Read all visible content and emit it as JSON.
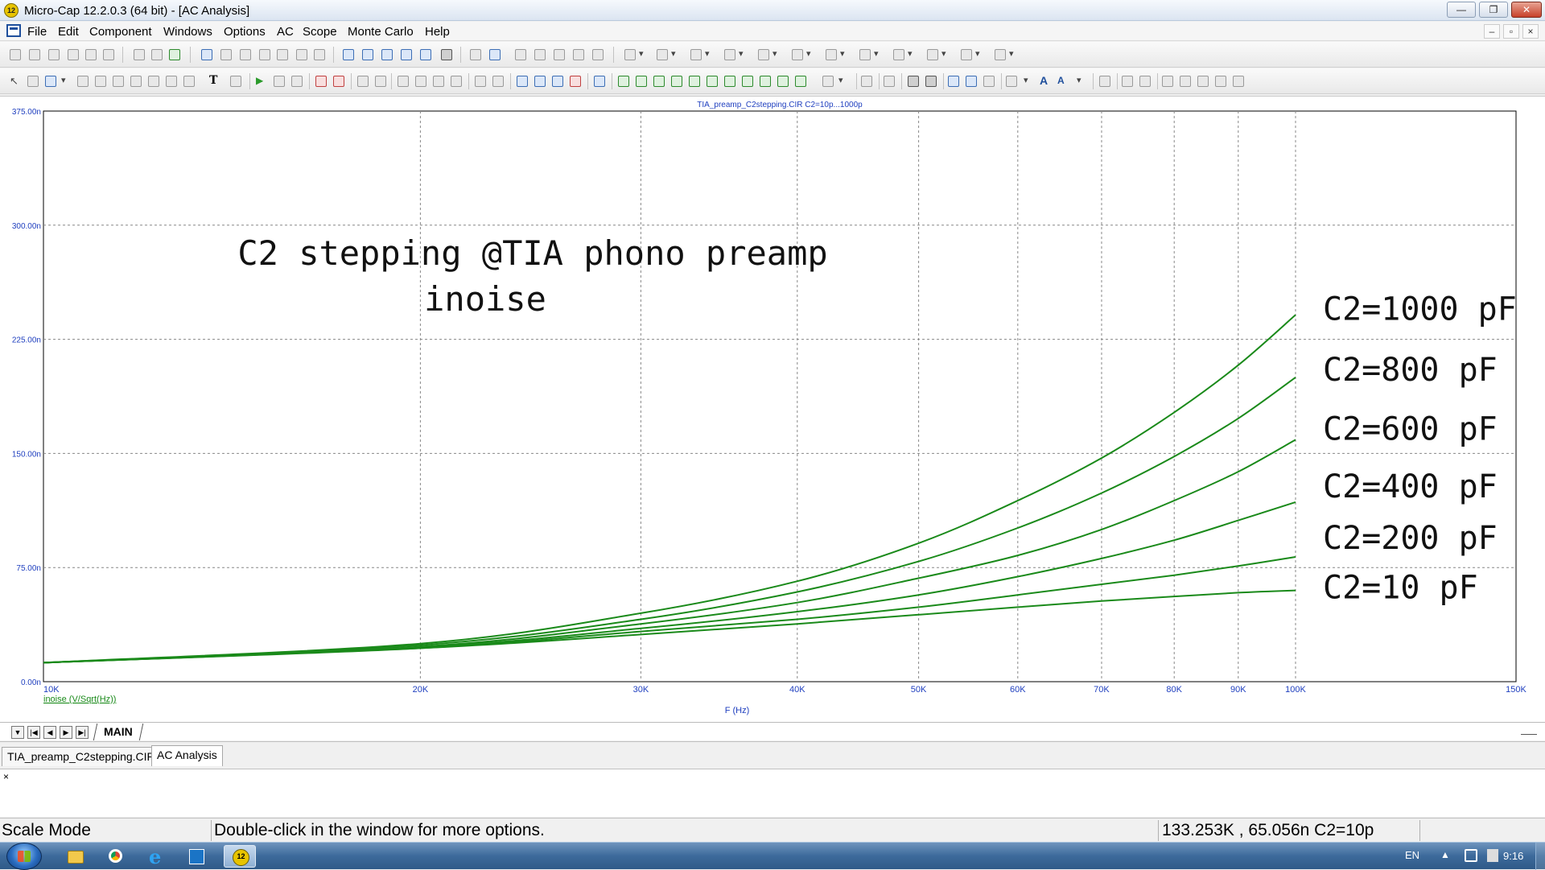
{
  "window": {
    "title": "Micro-Cap 12.2.0.3 (64 bit) - [AC Analysis]",
    "app_icon_text": "12",
    "minimize_glyph": "—",
    "restore_glyph": "❐",
    "close_glyph": "✕"
  },
  "menu": {
    "items": [
      "File",
      "Edit",
      "Component",
      "Windows",
      "Options",
      "AC",
      "Scope",
      "Monte Carlo",
      "Help"
    ],
    "mdi_min": "–",
    "mdi_restore": "▫",
    "mdi_close": "×"
  },
  "plot": {
    "header": "TIA_preamp_C2stepping.CIR C2=10p...1000p",
    "trace_label": "inoise (V/Sqrt(Hz))",
    "x_axis_label": "F (Hz)",
    "annotation_title": "C2 stepping @TIA phono preamp",
    "annotation_subtitle": "inoise",
    "trace_color": "#1a8a1a"
  },
  "chart_data": {
    "type": "line",
    "title": "TIA_preamp_C2stepping.CIR C2=10p...1000p",
    "xlabel": "F (Hz)",
    "ylabel": "inoise (V/Sqrt(Hz))",
    "x_scale": "log",
    "xlim": [
      10000,
      150000
    ],
    "ylim": [
      0,
      375
    ],
    "y_unit": "nV/Sqrt(Hz)",
    "grid": true,
    "x_ticks": [
      {
        "value": 10000,
        "label": "10K"
      },
      {
        "value": 20000,
        "label": "20K"
      },
      {
        "value": 30000,
        "label": "30K"
      },
      {
        "value": 40000,
        "label": "40K"
      },
      {
        "value": 50000,
        "label": "50K"
      },
      {
        "value": 60000,
        "label": "60K"
      },
      {
        "value": 70000,
        "label": "70K"
      },
      {
        "value": 80000,
        "label": "80K"
      },
      {
        "value": 90000,
        "label": "90K"
      },
      {
        "value": 100000,
        "label": "100K"
      },
      {
        "value": 150000,
        "label": "150K"
      }
    ],
    "y_ticks": [
      {
        "value": 0,
        "label": "0.00n"
      },
      {
        "value": 75,
        "label": "75.00n"
      },
      {
        "value": 150,
        "label": "150.00n"
      },
      {
        "value": 225,
        "label": "225.00n"
      },
      {
        "value": 300,
        "label": "300.00n"
      },
      {
        "value": 375,
        "label": "375.00n"
      }
    ],
    "x": [
      10000,
      20000,
      30000,
      40000,
      50000,
      60000,
      70000,
      80000,
      90000,
      100000
    ],
    "series": [
      {
        "name": "C2=1000 pF",
        "values": [
          12.5,
          25,
          45,
          66,
          91,
          119,
          147,
          177,
          208,
          241
        ]
      },
      {
        "name": "C2=800 pF",
        "values": [
          12.5,
          24,
          41,
          59,
          79,
          101,
          124,
          148,
          173,
          200
        ]
      },
      {
        "name": "C2=600 pF",
        "values": [
          12.5,
          23,
          38,
          52,
          68,
          83,
          100,
          119,
          138,
          159
        ]
      },
      {
        "name": "C2=400 pF",
        "values": [
          12.5,
          22.5,
          35,
          46,
          57,
          69,
          81,
          93,
          106,
          118
        ]
      },
      {
        "name": "C2=200 pF",
        "values": [
          12.5,
          22,
          33,
          41,
          49,
          57,
          64,
          70,
          76,
          82
        ]
      },
      {
        "name": "C2=10 pF",
        "values": [
          12.5,
          22,
          31,
          38,
          44,
          49,
          53,
          56,
          58.5,
          60
        ]
      }
    ]
  },
  "sheet_tabs": {
    "nav": [
      "▼",
      "|◀",
      "◀",
      "▶",
      "▶|"
    ],
    "active": "MAIN"
  },
  "doc_tabs": [
    "TIA_preamp_C2stepping.CIR",
    "AC Analysis"
  ],
  "output_pane": {
    "close_glyph": "×"
  },
  "status": {
    "mode": "Scale Mode",
    "message": "Double-click in the window for more options.",
    "coords": "133.253K , 65.056n C2=10p"
  },
  "taskbar": {
    "language": "EN",
    "tray_arrow": "▲",
    "clock": "9:16"
  }
}
